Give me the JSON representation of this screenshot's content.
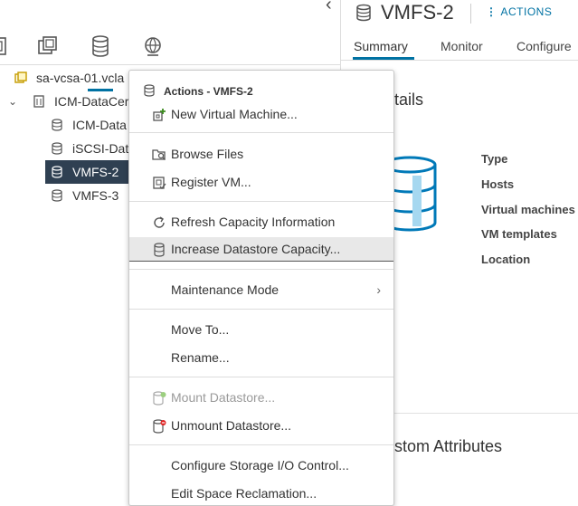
{
  "navigator": {
    "tree": {
      "vcenter": "sa-vcsa-01.vcla",
      "datacenter": "ICM-DataCer",
      "datastores": [
        "ICM-Data",
        "iSCSI-Dat",
        "VMFS-2",
        "VMFS-3"
      ],
      "selected": "VMFS-2"
    },
    "icons": [
      "hosts-clusters-icon",
      "vms-templates-icon",
      "storage-icon",
      "networking-icon"
    ],
    "active_icon": "storage-icon"
  },
  "object": {
    "title": "VMFS-2",
    "actions_label": "ACTIONS"
  },
  "tabs": [
    "Summary",
    "Monitor",
    "Configure"
  ],
  "active_tab": "Summary",
  "details_card": {
    "title": "tails",
    "labels": [
      "Type",
      "Hosts",
      "Virtual machines",
      "VM templates",
      "Location"
    ]
  },
  "custom_attributes_card": {
    "title": "stom Attributes"
  },
  "context_menu": {
    "header": "Actions - VMFS-2",
    "items": [
      {
        "label": "New Virtual Machine...",
        "icon": "new-vm-icon"
      },
      {
        "label": "Browse Files",
        "icon": "browse-files-icon"
      },
      {
        "label": "Register VM...",
        "icon": "register-vm-icon"
      },
      {
        "label": "Refresh Capacity Information",
        "icon": "refresh-icon"
      },
      {
        "label": "Increase Datastore Capacity...",
        "icon": "datastore-icon"
      },
      {
        "label": "Maintenance Mode",
        "icon": ""
      },
      {
        "label": "Move To...",
        "icon": ""
      },
      {
        "label": "Rename...",
        "icon": ""
      },
      {
        "label": "Mount Datastore...",
        "icon": "mount-datastore-icon"
      },
      {
        "label": "Unmount Datastore...",
        "icon": "unmount-datastore-icon"
      },
      {
        "label": "Configure Storage I/O Control...",
        "icon": ""
      },
      {
        "label": "Edit Space Reclamation...",
        "icon": ""
      }
    ]
  },
  "colors": {
    "accent": "#0072a3",
    "selected_row": "#2f4052",
    "menu_hover": "#e8e8e8"
  }
}
